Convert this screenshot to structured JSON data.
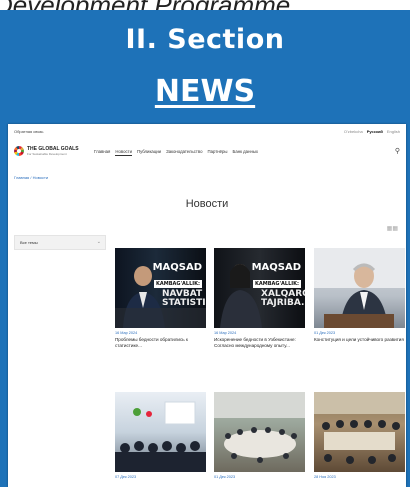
{
  "top_fragment": "Development Programme",
  "slide": {
    "section_title": "II. Section",
    "subtitle": "NEWS",
    "colors": {
      "background": "#1e72b8",
      "text": "#ffffff",
      "link": "#2a6ebd"
    }
  },
  "site": {
    "topbar_left": "Обратная связь",
    "languages": [
      "O'zbekcha",
      "Русский",
      "English"
    ],
    "active_language": "Русский",
    "logo_title": "THE GLOBAL GOALS",
    "logo_subtitle": "For Sustainable Development",
    "menu": [
      "Главная",
      "Новости",
      "Публикации",
      "Законодательство",
      "Партнёры",
      "Банк данных"
    ],
    "active_menu": "Новости",
    "search_icon": "search-icon",
    "breadcrumb_home": "Главная",
    "breadcrumb_current": "Новости",
    "page_title": "Новости",
    "view_icon": "grid-view-icon",
    "filter_label": "Все темы",
    "filter_icon": "chevron-down-icon",
    "cards": [
      {
        "overlay_top": "MAQSAD",
        "overlay_mid": "KAMBAG'ALLIK:",
        "overlay_bottom": "NAVBAT STATISTIKAGA",
        "date": "16 Мар 2024",
        "title": "Проблемы бедности обратились к статистике..."
      },
      {
        "overlay_top": "MAQSAD",
        "overlay_mid": "KAMBAG'ALLIK:",
        "overlay_bottom": "XALQARO TAJRIBA...",
        "date": "16 Мар 2024",
        "title": "Искоренение бедности в Узбекистане: Согласно международному опыту..."
      },
      {
        "date": "01 Дек 2023",
        "title": "Конституция и цели устойчивого развития"
      },
      {
        "date": "07 Дек 2023",
        "title": ""
      },
      {
        "date": "01 Дек 2023",
        "title": ""
      },
      {
        "date": "28 Ноя 2023",
        "title": ""
      }
    ]
  }
}
